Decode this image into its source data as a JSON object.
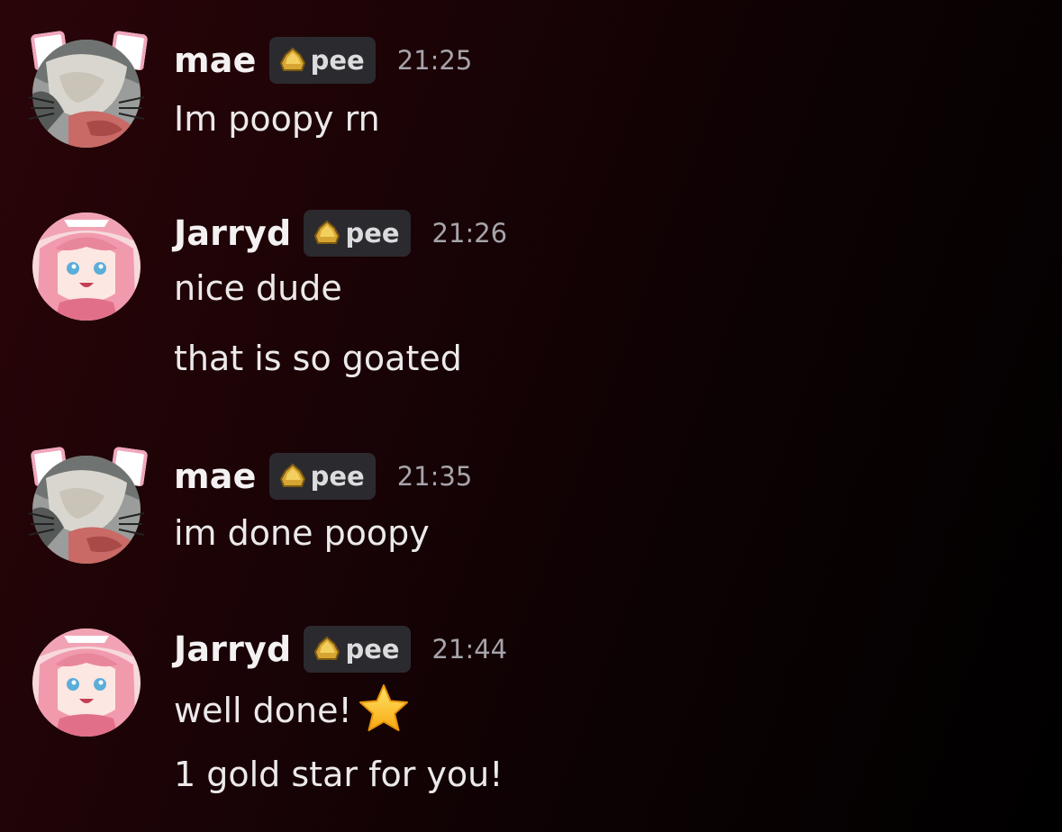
{
  "messages": [
    {
      "author": "mae",
      "tag": "pee",
      "time": "21:25",
      "avatar": "mae-avatar",
      "lines": [
        "Im poopy rn"
      ]
    },
    {
      "author": "Jarryd",
      "tag": "pee",
      "time": "21:26",
      "avatar": "jarryd-avatar",
      "lines": [
        "nice dude",
        "that is so goated"
      ]
    },
    {
      "author": "mae",
      "tag": "pee",
      "time": "21:35",
      "avatar": "mae-avatar",
      "lines": [
        "im done poopy"
      ]
    },
    {
      "author": "Jarryd",
      "tag": "pee",
      "time": "21:44",
      "avatar": "jarryd-avatar",
      "lines": [
        "well done!",
        "1 gold star for you!"
      ],
      "emoji": "star-emoji"
    }
  ],
  "colors": {
    "background_start": "#2a0508",
    "background_end": "#000000",
    "tag_background": "#2b2a2f",
    "tag_icon": "#d8a532",
    "timestamp": "#a6a4aa",
    "text": "#ece9ea"
  }
}
